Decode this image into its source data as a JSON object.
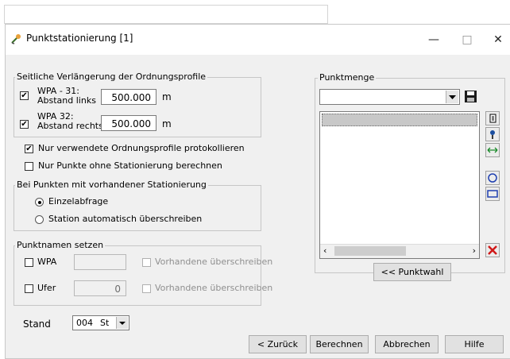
{
  "window": {
    "title": "Punktstationierung [1]",
    "controls": [
      "—",
      "□",
      "✕"
    ]
  },
  "profile_group": {
    "label": "Seitliche Verlängerung der Ordnungsprofile",
    "left": {
      "line1": "WPA - 31:",
      "line2": "Abstand links",
      "value": "500.000",
      "unit": "m",
      "checked": true
    },
    "right": {
      "line1": "WPA 32:",
      "line2": "Abstand rechts",
      "value": "500.000",
      "unit": "m",
      "checked": true
    }
  },
  "options": {
    "only_used": "Nur verwendete Ordnungsprofile protokollieren",
    "only_unstationed": "Nur Punkte ohne Stationierung berechnen"
  },
  "station_group": {
    "label": "Bei Punkten mit vorhandener Stationierung",
    "single_query": "Einzelabfrage",
    "auto_overwrite": "Station automatisch überschreiben"
  },
  "names_group": {
    "label": "Punktnamen setzen",
    "wpa": {
      "label": "WPA",
      "value": "",
      "overwrite": "Vorhandene überschreiben"
    },
    "ufer": {
      "label": "Ufer",
      "value": "0",
      "overwrite": "Vorhandene überschreiben"
    }
  },
  "stand": {
    "label": "Stand",
    "value": "004",
    "unit": "St"
  },
  "punktmenge": {
    "label": "Punktmenge",
    "select_value": "",
    "punktwahl_button": "<< Punktwahl"
  },
  "buttons": {
    "back": "< Zurück",
    "calculate": "Berechnen",
    "cancel": "Abbrechen",
    "help": "Hilfe"
  }
}
